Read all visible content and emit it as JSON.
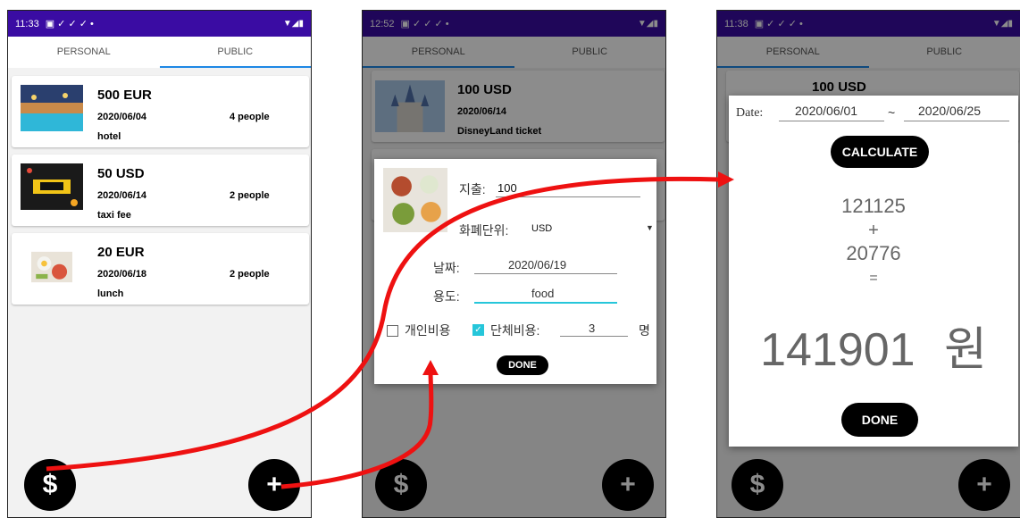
{
  "panel1": {
    "time": "11:33",
    "tabs": [
      "PERSONAL",
      "PUBLIC"
    ],
    "items": [
      {
        "amount": "500 EUR",
        "date": "2020/06/04",
        "people": "4 people",
        "memo": "hotel"
      },
      {
        "amount": "50 USD",
        "date": "2020/06/14",
        "people": "2 people",
        "memo": "taxi fee"
      },
      {
        "amount": "20 EUR",
        "date": "2020/06/18",
        "people": "2 people",
        "memo": "lunch"
      }
    ],
    "fab_dollar": "$",
    "fab_add": "+"
  },
  "panel2": {
    "time": "12:52",
    "tabs": [
      "PERSONAL",
      "PUBLIC"
    ],
    "items": [
      {
        "amount": "100 USD",
        "date": "2020/06/14",
        "memo": "DisneyLand ticket"
      }
    ],
    "dialog": {
      "expense_label": "지출:",
      "expense_value": "100",
      "currency_label": "화폐단위:",
      "currency_value": "USD",
      "date_label": "날짜:",
      "date_value": "2020/06/19",
      "purpose_label": "용도:",
      "purpose_value": "food",
      "personal_label": "개인비용",
      "group_label": "단체비용:",
      "group_count": "3",
      "group_unit": "명",
      "done": "DONE"
    }
  },
  "panel3": {
    "time": "11:38",
    "tabs": [
      "PERSONAL",
      "PUBLIC"
    ],
    "bg_amount": "100 USD",
    "dialog": {
      "date_label": "Date:",
      "date_from": "2020/06/01",
      "tilde": "~",
      "date_to": "2020/06/25",
      "calculate": "CALCULATE",
      "value1": "121125",
      "plus": "+",
      "value2": "20776",
      "equals": "=",
      "result": "141901",
      "result_unit": "원",
      "done": "DONE"
    }
  },
  "colors": {
    "status_bar": "#3a0ca3",
    "tab_indicator": "#1e88e5",
    "arrow": "#ee1111",
    "check": "#26c6da"
  }
}
